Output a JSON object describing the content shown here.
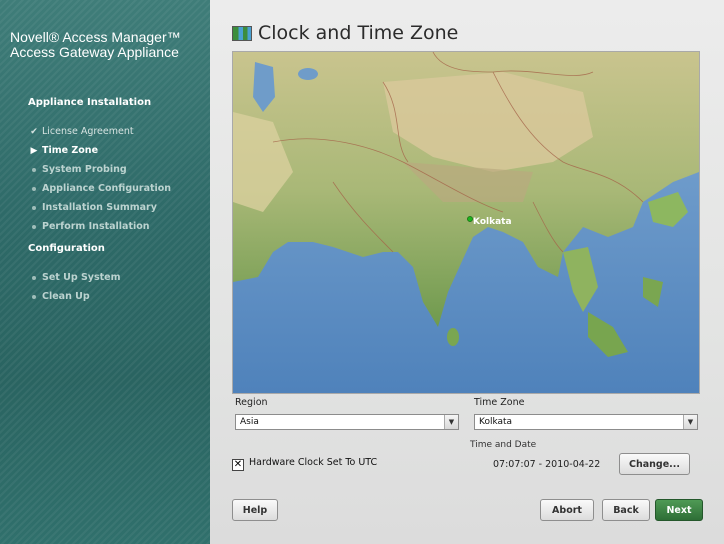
{
  "sidebar": {
    "product_line1": "Novell® Access Manager™",
    "product_line2": "Access Gateway Appliance",
    "section_install": "Appliance Installation",
    "install_steps": [
      {
        "label": "License Agreement",
        "state": "done"
      },
      {
        "label": "Time Zone",
        "state": "current"
      },
      {
        "label": "System Probing",
        "state": "pending"
      },
      {
        "label": "Appliance Configuration",
        "state": "pending"
      },
      {
        "label": "Installation Summary",
        "state": "pending"
      },
      {
        "label": "Perform Installation",
        "state": "pending"
      }
    ],
    "section_config": "Configuration",
    "config_steps": [
      {
        "label": "Set Up System",
        "state": "pending"
      },
      {
        "label": "Clean Up",
        "state": "pending"
      }
    ]
  },
  "page": {
    "title": "Clock and Time Zone",
    "title_icon": "world-map-icon"
  },
  "map": {
    "marker_label": "Kolkata"
  },
  "region": {
    "label": "Region",
    "value": "Asia"
  },
  "timezone": {
    "label": "Time Zone",
    "value": "Kolkata"
  },
  "time_and_date": {
    "label": "Time and Date",
    "value": "07:07:07 - 2010-04-22"
  },
  "hardware_clock": {
    "label": "Hardware Clock Set To UTC",
    "checked": true
  },
  "buttons": {
    "change": "Change...",
    "help": "Help",
    "abort": "Abort",
    "back": "Back",
    "next": "Next"
  }
}
